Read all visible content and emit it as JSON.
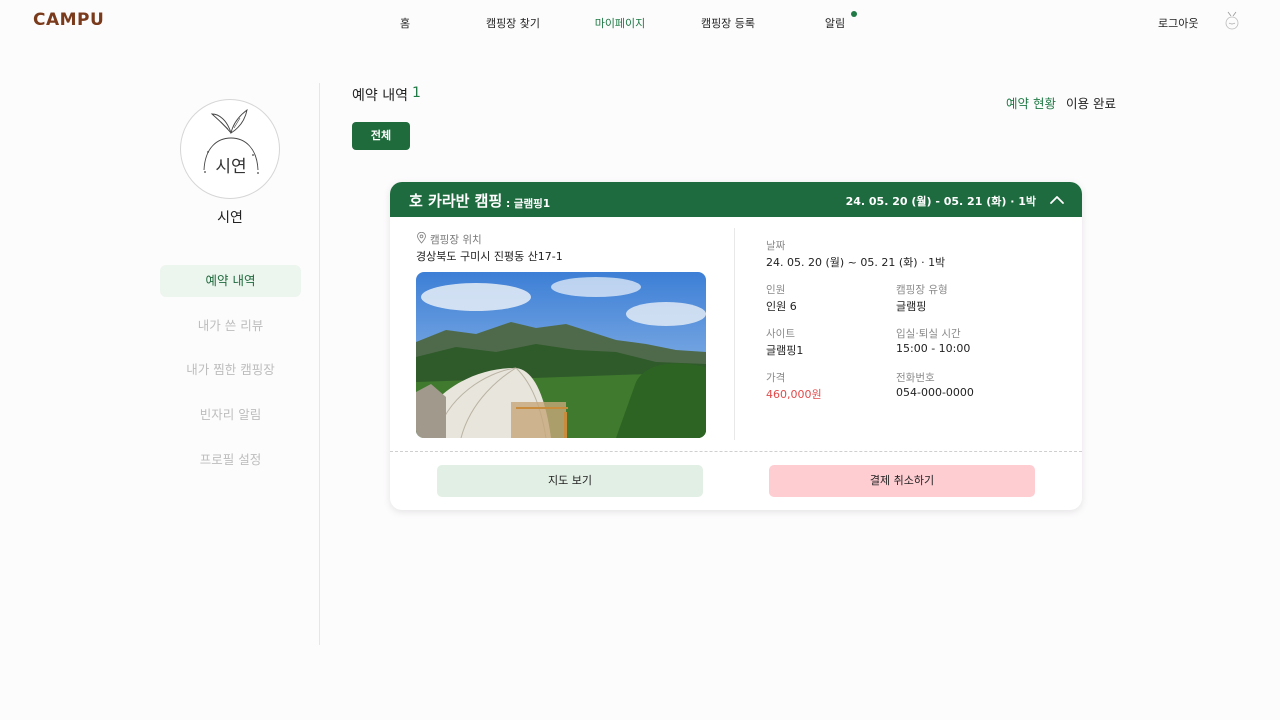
{
  "header": {
    "logo": "CAMPU",
    "nav": [
      {
        "label": "홈"
      },
      {
        "label": "캠핑장 찾기"
      },
      {
        "label": "마이페이지"
      },
      {
        "label": "캠핑장 등록"
      },
      {
        "label": "알림"
      }
    ],
    "logout": "로그아웃"
  },
  "sidebar": {
    "profile_handwriting": "시연",
    "username": "시연",
    "items": [
      {
        "label": "예약 내역"
      },
      {
        "label": "내가 쓴 리뷰"
      },
      {
        "label": "내가 찜한 캠핑장"
      },
      {
        "label": "빈자리 알림"
      },
      {
        "label": "프로필 설정"
      }
    ]
  },
  "main": {
    "title": "예약 내역",
    "count": "1",
    "status_current": "예약 현황",
    "status_done": "이용 완료",
    "filter_all": "전체"
  },
  "reservation": {
    "camp_name": "호 카라반 캠핑",
    "site_type": ": 글램핑1",
    "dates_header": "24. 05. 20 (월) - 05. 21 (화) · 1박",
    "location_label": "캠핑장 위치",
    "address": "경상북도 구미시 진평동 산17-1",
    "date_label": "날짜",
    "date_value": "24. 05. 20 (월) ~ 05. 21 (화) · 1박",
    "people_label": "인원",
    "people_value": "인원 6",
    "camp_type_label": "캠핑장 유형",
    "camp_type_value": "글램핑",
    "site_label": "사이트",
    "site_value": "글램핑1",
    "checkin_label": "입실·퇴실 시간",
    "checkin_value": "15:00 - 10:00",
    "price_label": "가격",
    "price_value": "460,000원",
    "phone_label": "전화번호",
    "phone_value": "054-000-0000",
    "map_button": "지도 보기",
    "cancel_button": "결제 취소하기"
  },
  "colors": {
    "brand_green": "#1e6b3f",
    "accent_green": "#1f7a45",
    "price_red": "#e24a4a",
    "cancel_pink": "#fdcdd2",
    "map_green_light": "#e2efe4"
  }
}
